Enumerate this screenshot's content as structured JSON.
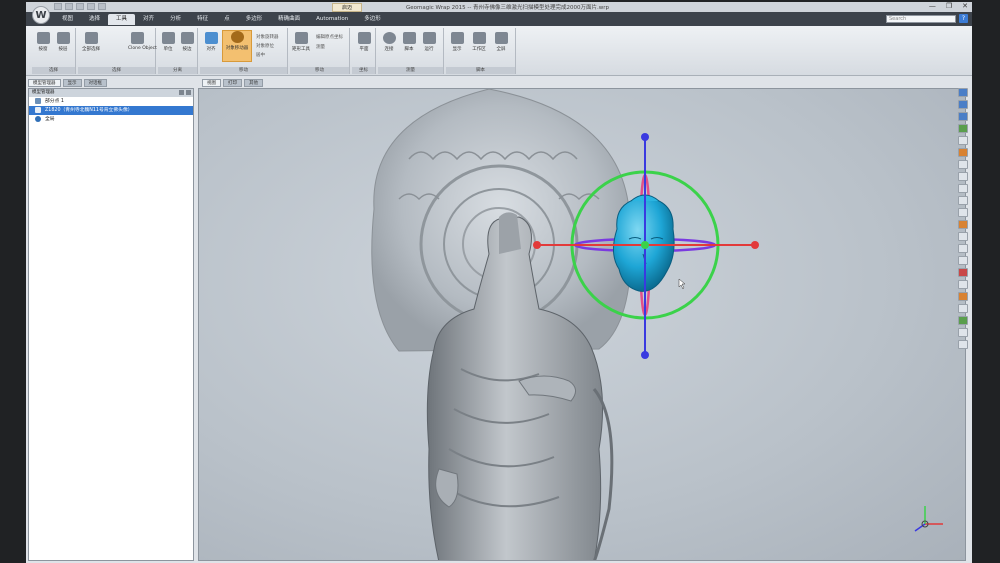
{
  "app": {
    "logo_letter": "W",
    "title_tab": "启迈",
    "title": "Geomagic Wrap 2015 -- 青州寺佛像三维激光扫描模型处理完成2000万面片.wrp",
    "window_controls": [
      "—",
      "❐",
      "✕"
    ]
  },
  "menu": {
    "tabs": [
      "视图",
      "选择",
      "工具",
      "对齐",
      "分析",
      "特征",
      "点",
      "多边形",
      "精确曲面",
      "Automation",
      "多边形"
    ],
    "active_index": 2,
    "search_placeholder": "Search"
  },
  "ribbon": {
    "groups": [
      {
        "label": "选择",
        "buttons": [
          "按窗",
          "按层"
        ]
      },
      {
        "label": "选择",
        "buttons": [
          "全部选择",
          "Clone Object"
        ]
      },
      {
        "label": "分离",
        "buttons": [
          "单位",
          "按边"
        ]
      },
      {
        "label": "移动",
        "buttons": [
          "对齐",
          "对象移动器"
        ],
        "small": [
          "对象旋转器",
          "对象原位",
          "居中"
        ]
      },
      {
        "label": "移动",
        "buttons": [
          "矩形工具"
        ],
        "small": [
          "编辑原点坐标",
          "测量"
        ]
      },
      {
        "label": "坐标",
        "buttons": [
          "平面"
        ]
      },
      {
        "label": "测量",
        "buttons": [
          "连接",
          "脚本",
          "运行"
        ]
      },
      {
        "label": "脚本",
        "buttons": [
          "显示",
          "工作区",
          "全屏"
        ]
      }
    ],
    "highlight_label": "对象移动器"
  },
  "left_panel": {
    "tabs": [
      "模型管理器",
      "显示",
      "对话框"
    ],
    "header": "模型管理器",
    "tree": [
      {
        "label": "部分点 1",
        "icon": "point-cloud-icon"
      },
      {
        "label": "Z1820（青州寺北魏N11号背立佛头像）",
        "icon": "mesh-icon",
        "selected": true
      },
      {
        "label": "全局",
        "icon": "globe-icon"
      }
    ]
  },
  "viewport": {
    "tabs": [
      "视图",
      "打印",
      "其他"
    ],
    "accent_colors": {
      "x_axis": "#e23a3a",
      "y_axis": "#3a3ae0",
      "ring": "#3bd24a",
      "head": "#1ea6d6",
      "ring_pink": "#e0508a"
    }
  }
}
